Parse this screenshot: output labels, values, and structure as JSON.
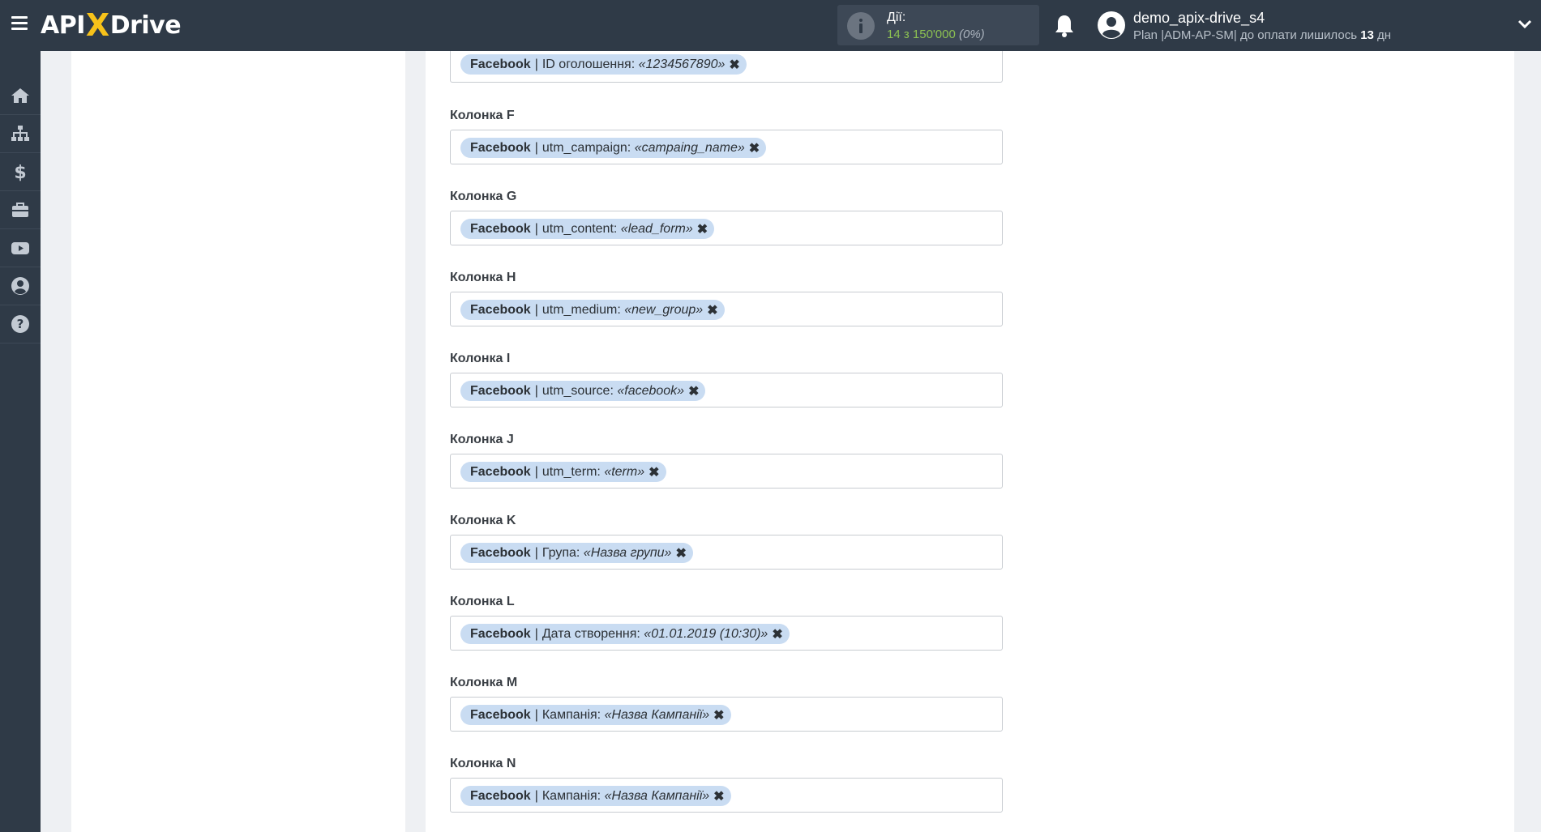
{
  "header": {
    "logo_part1": "API",
    "logo_x": "X",
    "logo_part2": "Drive",
    "actions_label": "Дії:",
    "actions_used": "14 з 150'000",
    "actions_percent": "(0%)",
    "username": "demo_apix-drive_s4",
    "plan_prefix": "Plan |ADM-AP-SM| до оплати лишилось",
    "plan_days": "13",
    "plan_suffix": "дн",
    "icons": [
      "menu-icon",
      "info-icon",
      "bell-icon",
      "user-icon",
      "chevron-down-icon"
    ]
  },
  "sidebar": {
    "items": [
      {
        "icon": "home-icon"
      },
      {
        "icon": "sitemap-icon"
      },
      {
        "icon": "dollar-icon"
      },
      {
        "icon": "briefcase-icon"
      },
      {
        "icon": "youtube-icon"
      },
      {
        "icon": "user-circle-icon"
      },
      {
        "icon": "help-icon"
      }
    ]
  },
  "fields": [
    {
      "label": "",
      "source": "Facebook",
      "sep": "|",
      "field": "ID оголошення:",
      "value": "«1234567890»",
      "remove": "✖"
    },
    {
      "label": "Колонка F",
      "source": "Facebook",
      "sep": "|",
      "field": "utm_campaign:",
      "value": "«campaing_name»",
      "remove": "✖"
    },
    {
      "label": "Колонка G",
      "source": "Facebook",
      "sep": "|",
      "field": "utm_content:",
      "value": "«lead_form»",
      "remove": "✖"
    },
    {
      "label": "Колонка H",
      "source": "Facebook",
      "sep": "|",
      "field": "utm_medium:",
      "value": "«new_group»",
      "remove": "✖"
    },
    {
      "label": "Колонка I",
      "source": "Facebook",
      "sep": "|",
      "field": "utm_source:",
      "value": "«facebook»",
      "remove": "✖"
    },
    {
      "label": "Колонка J",
      "source": "Facebook",
      "sep": "|",
      "field": "utm_term:",
      "value": "«term»",
      "remove": "✖"
    },
    {
      "label": "Колонка K",
      "source": "Facebook",
      "sep": "|",
      "field": "Група:",
      "value": "«Назва групи»",
      "remove": "✖"
    },
    {
      "label": "Колонка L",
      "source": "Facebook",
      "sep": "|",
      "field": "Дата створення:",
      "value": "«01.01.2019 (10:30)»",
      "remove": "✖"
    },
    {
      "label": "Колонка M",
      "source": "Facebook",
      "sep": "|",
      "field": "Кампанія:",
      "value": "«Назва Кампанії»",
      "remove": "✖"
    },
    {
      "label": "Колонка N",
      "source": "Facebook",
      "sep": "|",
      "field": "Кампанія:",
      "value": "«Назва Кампанії»",
      "remove": "✖"
    }
  ]
}
